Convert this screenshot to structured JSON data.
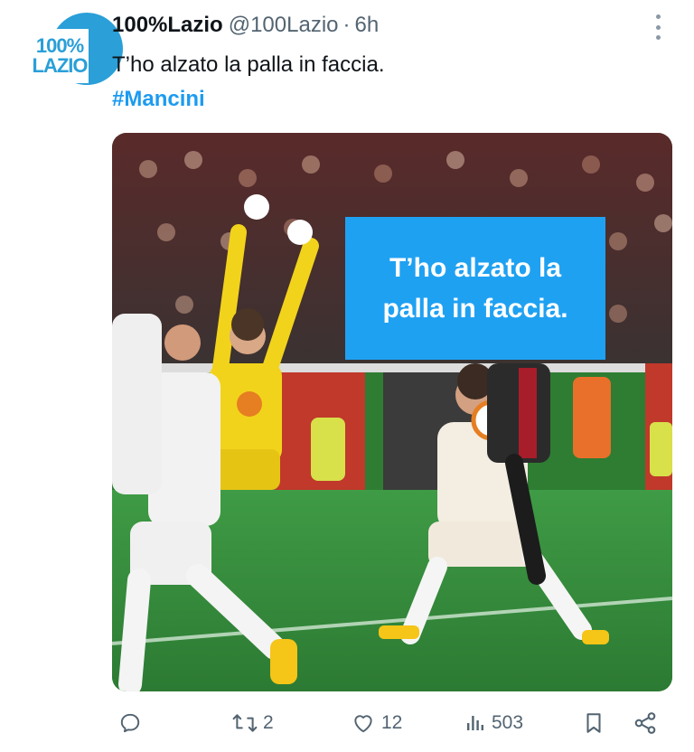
{
  "tweet": {
    "display_name": "100%Lazio",
    "handle": "@100Lazio",
    "separator": "·",
    "time": "6h",
    "text": "T’ho alzato la palla in faccia.",
    "hashtag": "#Mancini"
  },
  "avatar": {
    "line1": "100%",
    "line2": "LAZIO",
    "color": "#2a9fd8"
  },
  "media": {
    "overlay_text": "T’ho alzato la palla in faccia.",
    "overlay_color": "#1fa1f2",
    "pitch_color": "#2e7d32"
  },
  "actions": {
    "reply": {
      "icon": "reply-icon",
      "count": ""
    },
    "retweet": {
      "icon": "retweet-icon",
      "count": "2"
    },
    "like": {
      "icon": "heart-icon",
      "count": "12"
    },
    "views": {
      "icon": "views-icon",
      "count": "503"
    },
    "bookmark": {
      "icon": "bookmark-icon"
    },
    "share": {
      "icon": "share-icon"
    }
  }
}
